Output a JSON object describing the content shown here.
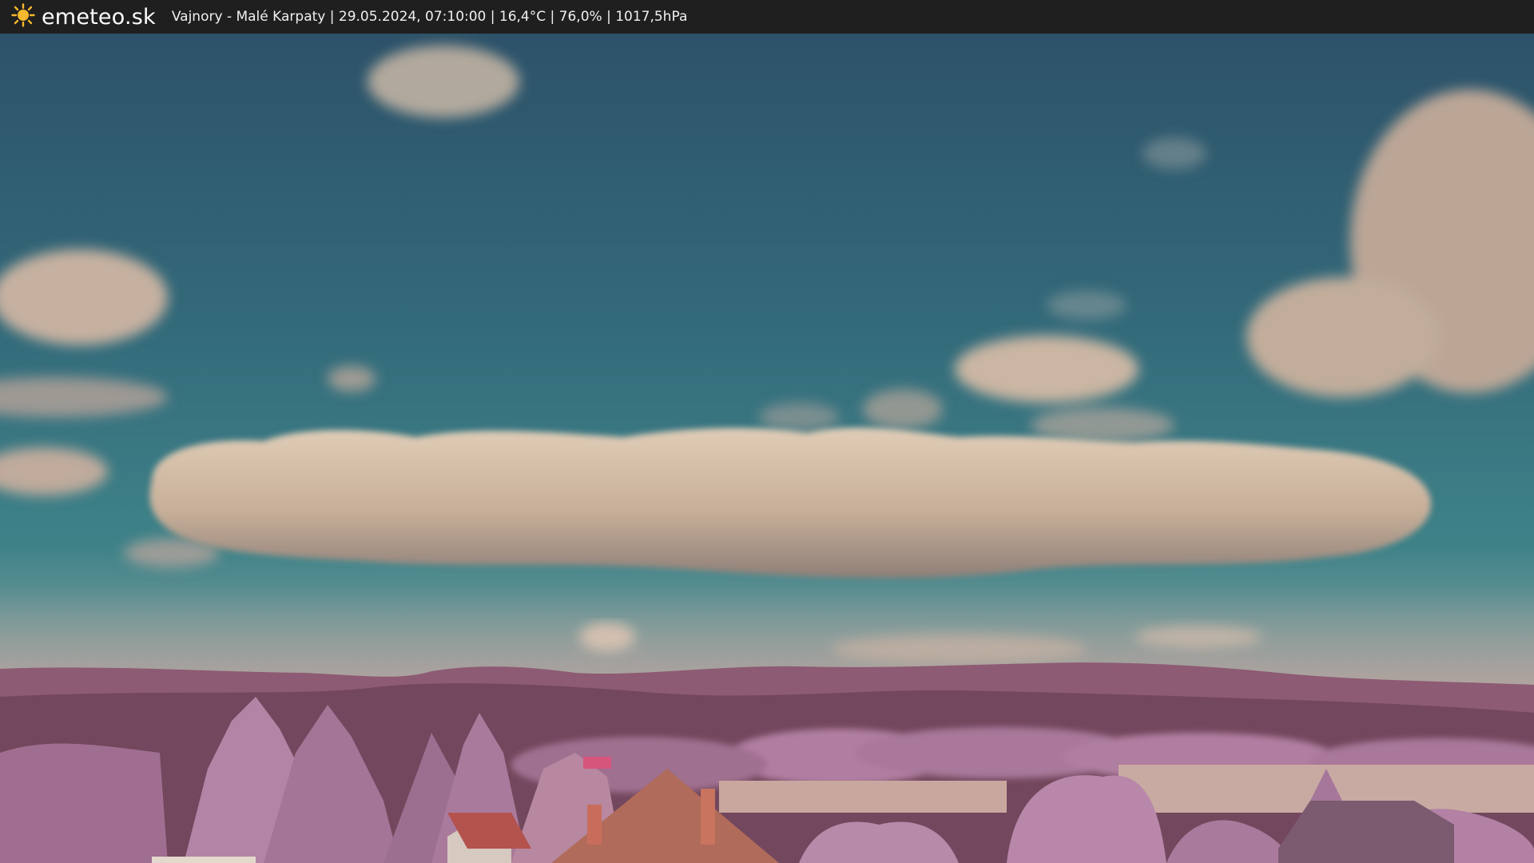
{
  "header": {
    "logo_text": "emeteo.sk",
    "caption": "Vajnory - Malé Karpaty | 29.05.2024, 07:10:00 | 16,4°C | 76,0% | 1017,5hPa",
    "logo_icon": "sun-icon"
  },
  "colors": {
    "bar": "#1f1f1f",
    "sky_top": "#2f5870",
    "sky_mid": "#3a7b86",
    "cloud": "#cdb7a2",
    "hills": "#8a5a73",
    "trees": "#b27da6",
    "sun": "#f5b82e"
  }
}
